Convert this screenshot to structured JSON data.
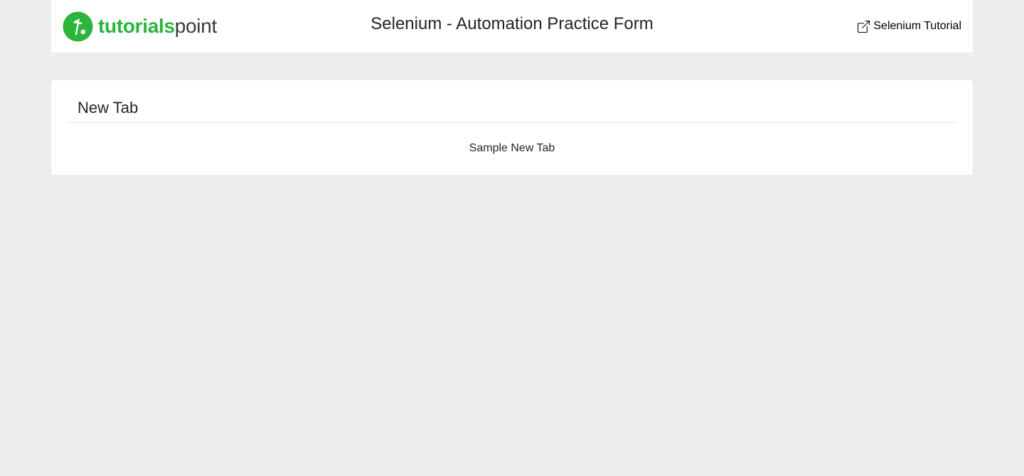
{
  "header": {
    "logo": {
      "text_bold": "tutorials",
      "text_light": "point",
      "brand_color": "#2bb53a"
    },
    "title": "Selenium - Automation Practice Form",
    "tutorial_link": {
      "icon": "external-link-icon",
      "label": "Selenium Tutorial"
    }
  },
  "card": {
    "title": "New Tab",
    "body_text": "Sample New Tab"
  },
  "colors": {
    "page_background": "#ededed",
    "surface": "#ffffff",
    "text": "#212529",
    "divider": "#dee2e6"
  }
}
